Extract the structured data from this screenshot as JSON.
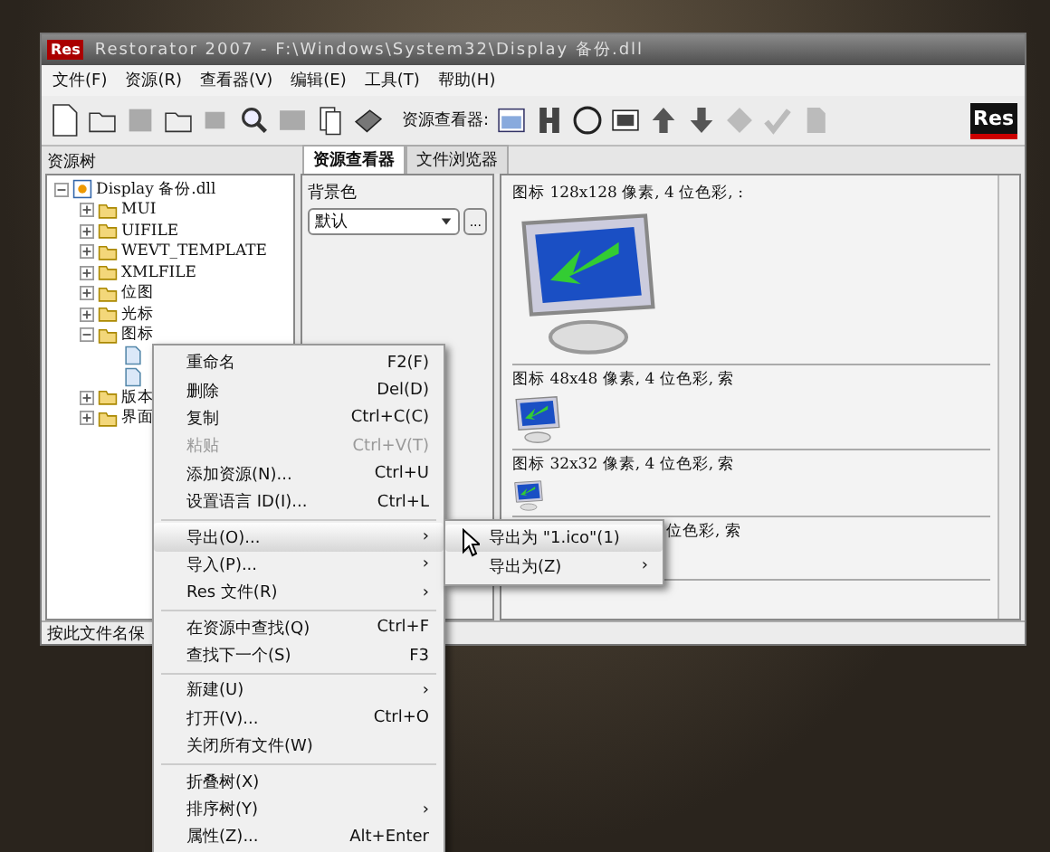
{
  "window": {
    "title": "Restorator 2007 - F:\\Windows\\System32\\Display 备份.dll",
    "icon_text": "Res"
  },
  "menubar": [
    {
      "label": "文件(F)"
    },
    {
      "label": "资源(R)"
    },
    {
      "label": "查看器(V)"
    },
    {
      "label": "编辑(E)"
    },
    {
      "label": "工具(T)"
    },
    {
      "label": "帮助(H)"
    }
  ],
  "toolbar": {
    "viewer_label": "资源查看器:",
    "logo": "Res"
  },
  "tree": {
    "title": "资源树",
    "items": [
      {
        "label": "Display 备份.dll",
        "kind": "file",
        "expanded": true,
        "children": [
          {
            "label": "MUI",
            "kind": "folder",
            "expanded": false
          },
          {
            "label": "UIFILE",
            "kind": "folder",
            "expanded": false
          },
          {
            "label": "WEVT_TEMPLATE",
            "kind": "folder",
            "expanded": false
          },
          {
            "label": "XMLFILE",
            "kind": "folder",
            "expanded": false
          },
          {
            "label": "位图",
            "kind": "folder",
            "expanded": false
          },
          {
            "label": "光标",
            "kind": "folder",
            "expanded": false
          },
          {
            "label": "图标",
            "kind": "folder",
            "expanded": true,
            "children": [
              {
                "kind": "doc"
              },
              {
                "kind": "doc"
              }
            ]
          },
          {
            "label": "版本",
            "kind": "folder",
            "expanded": false
          },
          {
            "label": "界面",
            "kind": "folder",
            "expanded": false
          }
        ]
      }
    ]
  },
  "tabs": [
    {
      "label": "资源查看器",
      "selected": true
    },
    {
      "label": "文件浏览器",
      "selected": false
    }
  ],
  "background": {
    "label": "背景色",
    "value": "默认",
    "more": "..."
  },
  "previews": [
    {
      "caption": "图标 128x128 像素, 4 位色彩, :",
      "kind": "large"
    },
    {
      "caption": "图标 48x48 像素, 4 位色彩, 索",
      "kind": "medium"
    },
    {
      "caption": "图标 32x32 像素, 4 位色彩, 索",
      "kind": "small"
    },
    {
      "caption": "位色彩, 索",
      "kind": "covered"
    }
  ],
  "status_bar": {
    "text": "按此文件名保"
  },
  "context_menu": {
    "groups": [
      [
        {
          "label": "重命名",
          "shortcut": "F2(F)",
          "disabled": false,
          "submenu": false,
          "selected": false
        },
        {
          "label": "删除",
          "shortcut": "Del(D)",
          "disabled": false,
          "submenu": false,
          "selected": false
        },
        {
          "label": "复制",
          "shortcut": "Ctrl+C(C)",
          "disabled": false,
          "submenu": false,
          "selected": false
        },
        {
          "label": "粘贴",
          "shortcut": "Ctrl+V(T)",
          "disabled": true,
          "submenu": false,
          "selected": false
        },
        {
          "label": "添加资源(N)...",
          "shortcut": "Ctrl+U",
          "disabled": false,
          "submenu": false,
          "selected": false
        },
        {
          "label": "设置语言 ID(I)...",
          "shortcut": "Ctrl+L",
          "disabled": false,
          "submenu": false,
          "selected": false
        }
      ],
      [
        {
          "label": "导出(O)...",
          "disabled": false,
          "submenu": true,
          "selected": true
        },
        {
          "label": "导入(P)...",
          "disabled": false,
          "submenu": true,
          "selected": false
        },
        {
          "label": "Res 文件(R)",
          "disabled": false,
          "submenu": true,
          "selected": false
        }
      ],
      [
        {
          "label": "在资源中查找(Q)",
          "shortcut": "Ctrl+F",
          "disabled": false,
          "submenu": false,
          "selected": false
        },
        {
          "label": "查找下一个(S)",
          "shortcut": "F3",
          "disabled": false,
          "submenu": false,
          "selected": false
        }
      ],
      [
        {
          "label": "新建(U)",
          "disabled": false,
          "submenu": true,
          "selected": false
        },
        {
          "label": "打开(V)...",
          "shortcut": "Ctrl+O",
          "disabled": false,
          "submenu": false,
          "selected": false
        },
        {
          "label": "关闭所有文件(W)",
          "disabled": false,
          "submenu": false,
          "selected": false
        }
      ],
      [
        {
          "label": "折叠树(X)",
          "disabled": false,
          "submenu": false,
          "selected": false
        },
        {
          "label": "排序树(Y)",
          "disabled": false,
          "submenu": true,
          "selected": false
        },
        {
          "label": "属性(Z)...",
          "shortcut": "Alt+Enter",
          "disabled": false,
          "submenu": false,
          "selected": false
        }
      ]
    ],
    "submenu": [
      {
        "label": "导出为 \"1.ico\"(1)",
        "submenu": false,
        "selected": true
      },
      {
        "label": "导出为(Z)",
        "submenu": true,
        "selected": false
      }
    ],
    "arrow": "›"
  }
}
